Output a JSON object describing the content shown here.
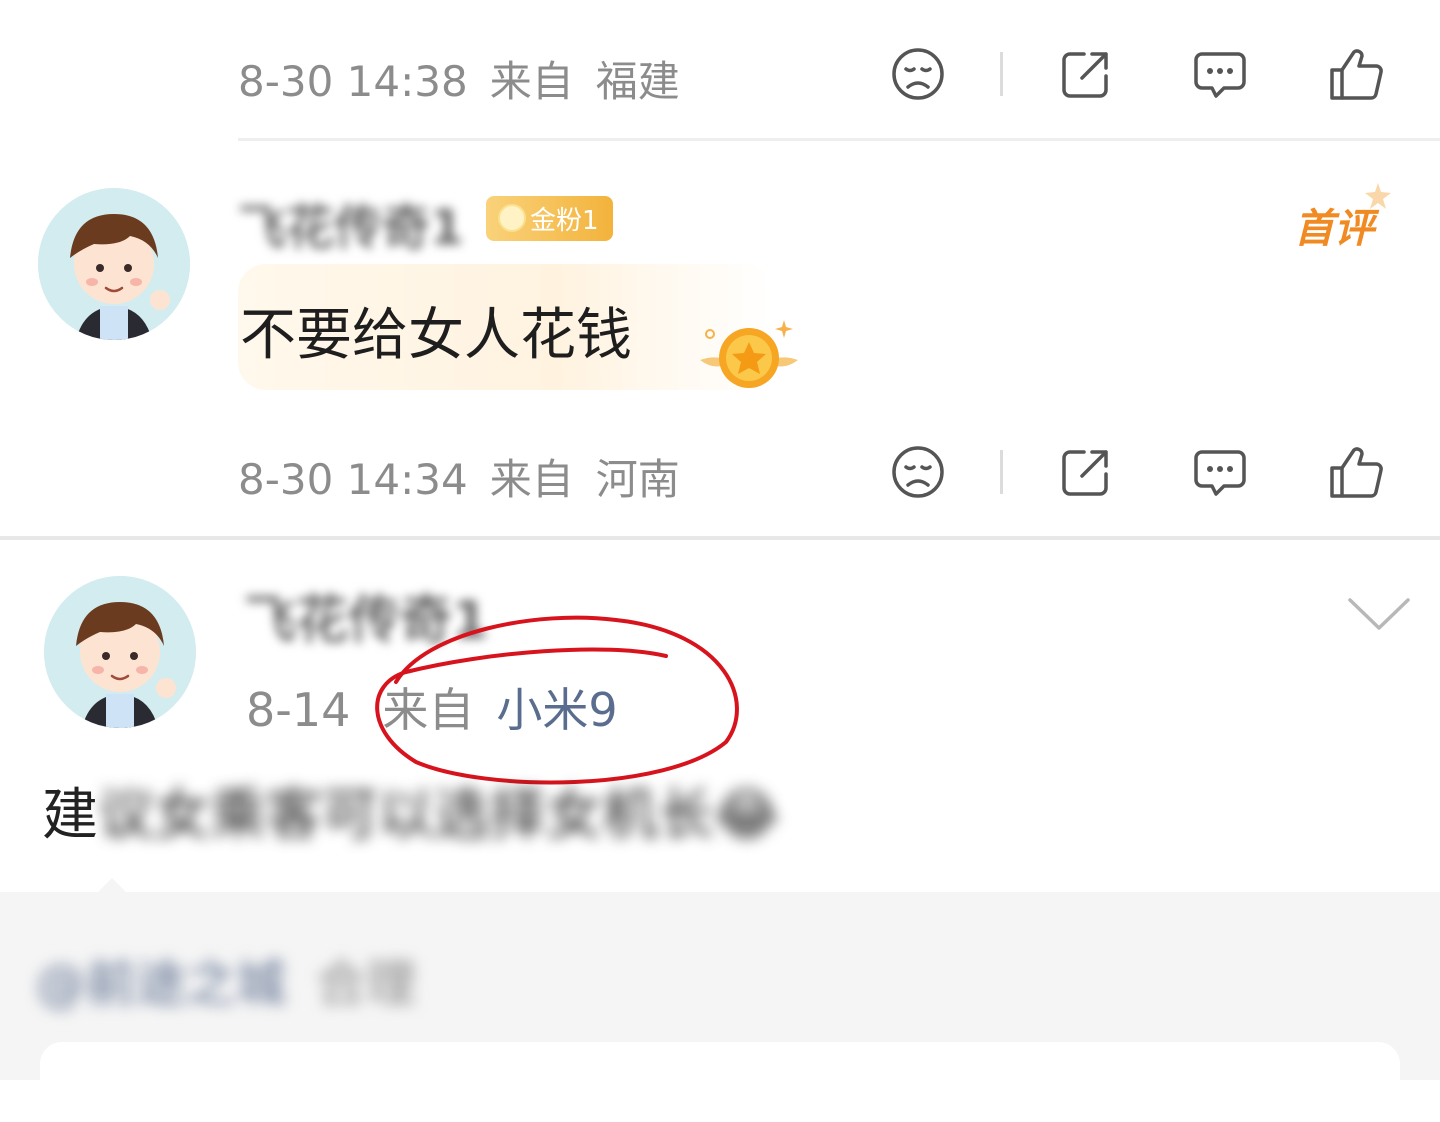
{
  "comments": [
    {
      "meta": {
        "time": "8-30 14:38",
        "from_label": "来自",
        "location": "福建"
      }
    },
    {
      "username": "飞花传奇1",
      "fan_badge": "金粉1",
      "first_tag": "首评",
      "text": "不要给女人花钱",
      "meta": {
        "time": "8-30 14:34",
        "from_label": "来自",
        "location": "河南"
      }
    }
  ],
  "post": {
    "username": "飞花传奇1",
    "date": "8-14",
    "from_label": "来自",
    "device": "小米9",
    "text_first_char": "建",
    "text_blurred": "议女乘客可以选择女机长",
    "emoji": "😂"
  },
  "reply": {
    "mention": "@前途之城",
    "text_blurred": "合理"
  },
  "icons": [
    "dislike-icon",
    "share-icon",
    "comment-icon",
    "like-icon",
    "chevron-down-icon"
  ],
  "colors": {
    "annotation": "#d7141d",
    "first_tag": "#f08a22",
    "link": "#5b6d8e",
    "meta": "#8c8c8c"
  }
}
